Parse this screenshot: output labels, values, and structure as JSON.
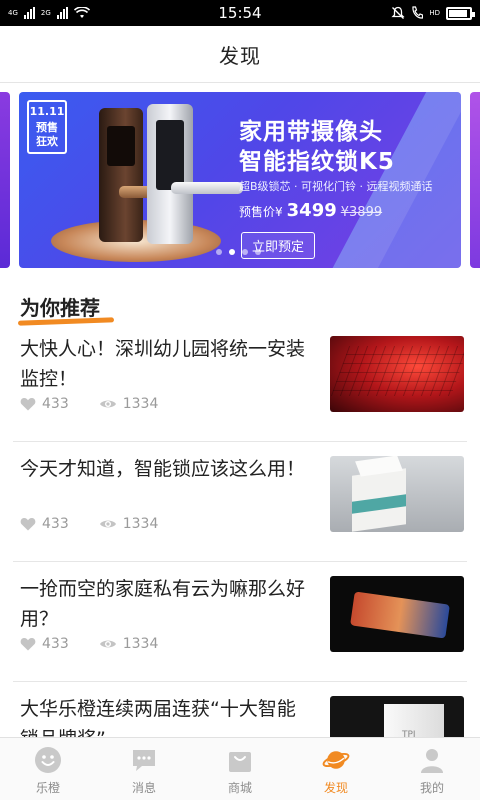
{
  "status_bar": {
    "time": "15:54",
    "network_left": "4G",
    "network_right": "2G",
    "hd_label": "HD",
    "battery_level": 0.9
  },
  "header": {
    "title": "发现"
  },
  "banner": {
    "badge_line1": "11.11",
    "badge_line2": "预售",
    "badge_line3": "狂欢",
    "title_line1": "家用带摄像头",
    "title_line2": "智能指纹锁K5",
    "features": "超B级锁芯 · 可视化门铃 · 远程视频通话",
    "price_label": "预售价¥",
    "price": "3499",
    "old_price": "¥3899",
    "cta": "立即预定",
    "dots_total": 4,
    "dots_active_index": 1,
    "colors": {
      "start": "#3a5cf0",
      "end": "#7b3fe3"
    }
  },
  "section": {
    "title": "为你推荐"
  },
  "articles": [
    {
      "title": "大快人心！深圳幼儿园将统一安装监控！",
      "likes": "433",
      "views": "1334",
      "thumb": "red-keyboard"
    },
    {
      "title": "今天才知道，智能锁应该这么用！",
      "likes": "433",
      "views": "1334",
      "thumb": "grey-box"
    },
    {
      "title": "一抢而空的家庭私有云为嘛那么好用？",
      "likes": "433",
      "views": "1334",
      "thumb": "dark-phone"
    },
    {
      "title": "大华乐橙连续两届连获“十大智能锁品牌奖”",
      "thumb": "white-cube",
      "thumb_text": "TPI"
    }
  ],
  "tabbar": {
    "items": [
      {
        "label": "乐橙",
        "icon": "smile-icon"
      },
      {
        "label": "消息",
        "icon": "message-icon"
      },
      {
        "label": "商城",
        "icon": "bag-icon"
      },
      {
        "label": "发现",
        "icon": "planet-icon"
      },
      {
        "label": "我的",
        "icon": "person-icon"
      }
    ],
    "active_index": 3,
    "accent": "#f18a22",
    "inactive": "#8c8c8c"
  }
}
